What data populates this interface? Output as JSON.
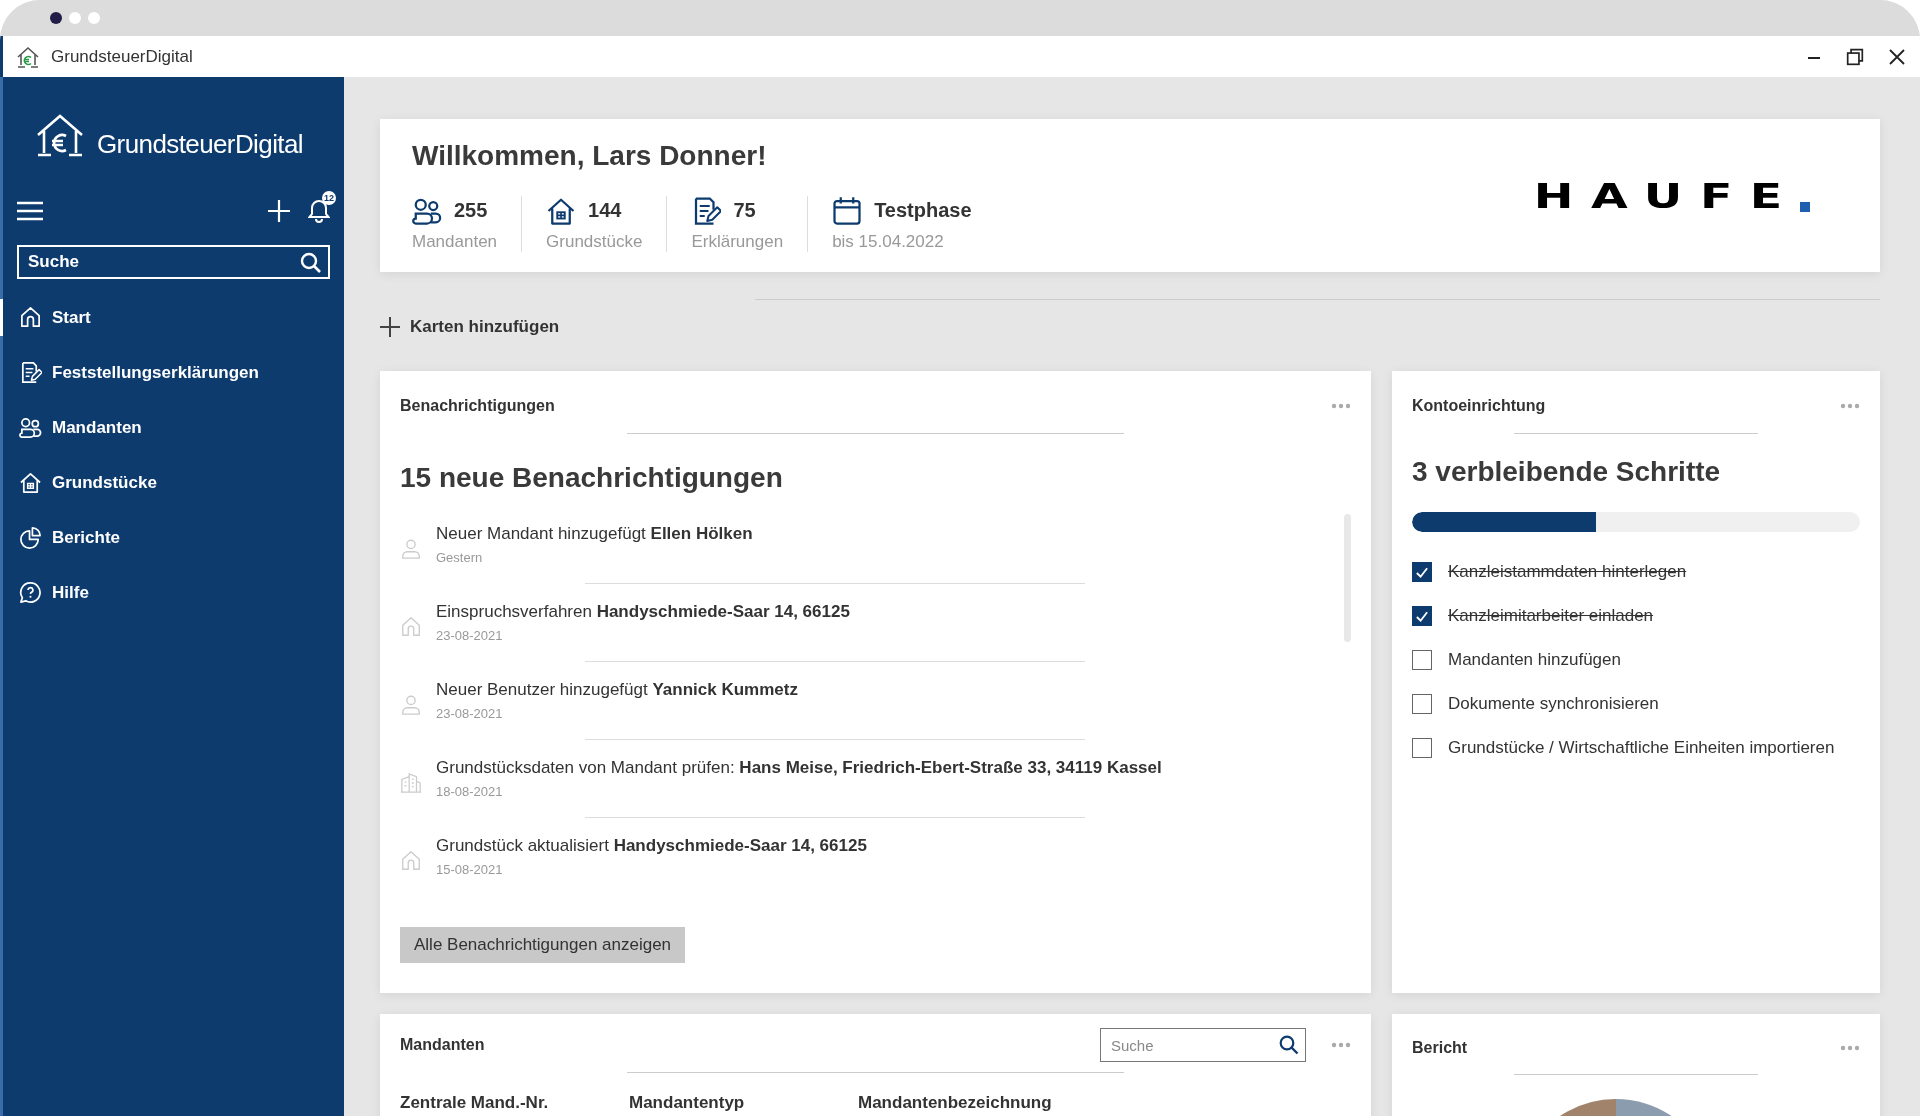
{
  "window": {
    "title": "GrundsteuerDigital"
  },
  "sidebar": {
    "brand": "GrundsteuerDigital",
    "notification_count": "12",
    "search": {
      "placeholder": "Suche"
    },
    "items": [
      {
        "kind": "home",
        "label": "Start",
        "selected": true
      },
      {
        "kind": "document",
        "label": "Feststellungserklärungen",
        "selected": false
      },
      {
        "kind": "people",
        "label": "Mandanten",
        "selected": false
      },
      {
        "kind": "property",
        "label": "Grundstücke",
        "selected": false
      },
      {
        "kind": "chart",
        "label": "Berichte",
        "selected": false
      },
      {
        "kind": "help",
        "label": "Hilfe",
        "selected": false
      }
    ]
  },
  "welcome": {
    "title": "Willkommen, Lars Donner!",
    "logo": "HAUFE",
    "stats": [
      {
        "kind": "people",
        "value": "255",
        "label": "Mandanten"
      },
      {
        "kind": "property",
        "value": "144",
        "label": "Grundstücke"
      },
      {
        "kind": "document",
        "value": "75",
        "label": "Erklärungen"
      },
      {
        "kind": "calendar",
        "value": "Testphase",
        "label": "bis 15.04.2022"
      }
    ]
  },
  "add_cards": "Karten hinzufügen",
  "notifications": {
    "title": "Benachrichtigungen",
    "heading": "15 neue Benachrichtigungen",
    "button": "Alle Benachrichtigungen anzeigen",
    "items": [
      {
        "kind": "person",
        "text": "Neuer Mandant hinzugefügt **Ellen Hölken**",
        "date": "Gestern"
      },
      {
        "kind": "house",
        "text": "Einspruchsverfahren **Handyschmiede-Saar 14, 66125**",
        "date": "23-08-2021"
      },
      {
        "kind": "person",
        "text": "Neuer Benutzer hinzugefügt **Yannick Kummetz**",
        "date": "23-08-2021"
      },
      {
        "kind": "building",
        "text": "Grundstücksdaten von Mandant prüfen: **Hans Meise, Friedrich-Ebert-Straße 33, 34119 Kassel**",
        "date": "18-08-2021"
      },
      {
        "kind": "house",
        "text": "Grundstück aktualisiert **Handyschmiede-Saar 14, 66125**",
        "date": "15-08-2021"
      }
    ]
  },
  "setup": {
    "title": "Kontoeinrichtung",
    "heading": "3 verbleibende Schritte",
    "level": 0.41,
    "steps": [
      {
        "label": "Kanzleistammdaten hinterlegen",
        "checked": true
      },
      {
        "label": "Kanzleimitarbeiter einladen",
        "checked": true
      },
      {
        "label": "Mandanten hinzufügen",
        "checked": false
      },
      {
        "label": "Dokumente synchronisieren",
        "checked": false
      },
      {
        "label": "Grundstücke / Wirtschaftliche Einheiten importieren",
        "checked": false
      }
    ]
  },
  "clients": {
    "title": "Mandanten",
    "search": {
      "placeholder": "Suche"
    },
    "columns": [
      "Zentrale Mand.-Nr.",
      "Mandantentyp",
      "Mandantenbezeichnung"
    ]
  },
  "report": {
    "title": "Bericht"
  }
}
